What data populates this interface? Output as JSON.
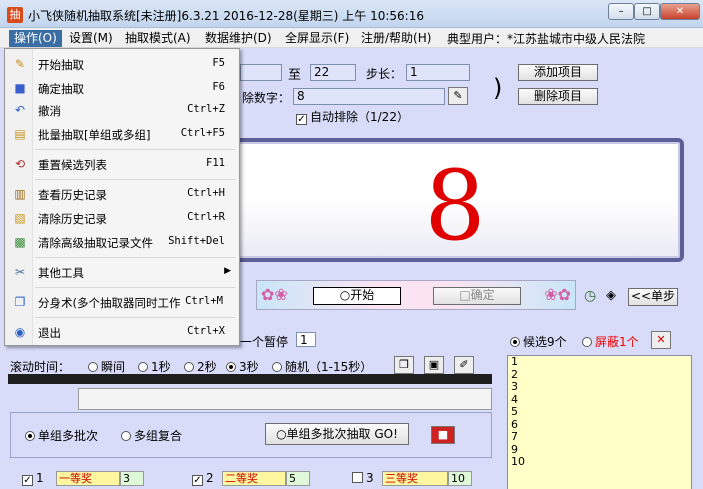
{
  "window": {
    "title": "小飞侠随机抽取系统[未注册]6.3.21 2016-12-28(星期三) 上午 10:56:16",
    "min": "–",
    "max": "□",
    "close": "✕"
  },
  "menu": {
    "items": [
      "操作(O)",
      "设置(M)",
      "抽取模式(A)",
      "数据维护(D)",
      "全屏显示(F)",
      "注册/帮助(H)"
    ],
    "typical_user": "典型用户：*江苏盐城市中级人民法院"
  },
  "range": {
    "to_label": "至",
    "to_value": "22",
    "step_label": "步长：",
    "step_value": "1",
    "exclude_label": "除数字：",
    "exclude_value": "8",
    "paren": ")",
    "auto_exclude": "自动排除（1/22）"
  },
  "buttons": {
    "add_item": "添加项目",
    "delete_item": "删除项目",
    "start": "○开始",
    "confirm": "□确定",
    "single_step": "<<单步",
    "multi_batch": "○单组多批次抽取 GO!"
  },
  "display": {
    "number": "8"
  },
  "pause": {
    "label": "一个暂停",
    "value": "1"
  },
  "candidates": {
    "pending_label": "候选9个",
    "shielded_label": "屏蔽1个",
    "items": [
      "1",
      "2",
      "3",
      "4",
      "5",
      "6",
      "7",
      "9",
      "10"
    ]
  },
  "scroll_time": {
    "label": "滚动时间：",
    "options": [
      "瞬间",
      "1秒",
      "2秒",
      "3秒",
      "随机（1-15秒）"
    ],
    "selected": "3秒"
  },
  "mode": {
    "options": [
      "单组多批次",
      "多组复合"
    ],
    "selected": "单组多批次"
  },
  "prizes": [
    {
      "idx": "1",
      "name": "一等奖",
      "count": "3"
    },
    {
      "idx": "2",
      "name": "二等奖",
      "count": "5"
    },
    {
      "idx": "3",
      "name": "三等奖",
      "count": "10"
    }
  ],
  "dropdown": {
    "items": [
      {
        "label": "开始抽取",
        "shortcut": "F5",
        "icon": "pencil-icon"
      },
      {
        "label": "确定抽取",
        "shortcut": "F6",
        "icon": "square-icon"
      },
      {
        "label": "撤消",
        "shortcut": "Ctrl+Z",
        "icon": "undo-icon"
      },
      {
        "label": "批量抽取[单组或多组]",
        "shortcut": "Ctrl+F5",
        "icon": "batch-icon"
      },
      {
        "label": "重置候选列表",
        "shortcut": "F11",
        "icon": "reset-icon"
      },
      {
        "label": "查看历史记录",
        "shortcut": "Ctrl+H",
        "icon": "history-icon"
      },
      {
        "label": "清除历史记录",
        "shortcut": "Ctrl+R",
        "icon": "clear-history-icon"
      },
      {
        "label": "清除高级抽取记录文件",
        "shortcut": "Shift+Del",
        "icon": "clear-file-icon"
      },
      {
        "label": "其他工具",
        "shortcut": "",
        "icon": "tools-icon"
      },
      {
        "label": "分身术(多个抽取器同时工作",
        "shortcut": "Ctrl+M",
        "icon": "clone-icon"
      },
      {
        "label": "退出",
        "shortcut": "Ctrl+X",
        "icon": "exit-icon"
      }
    ]
  }
}
